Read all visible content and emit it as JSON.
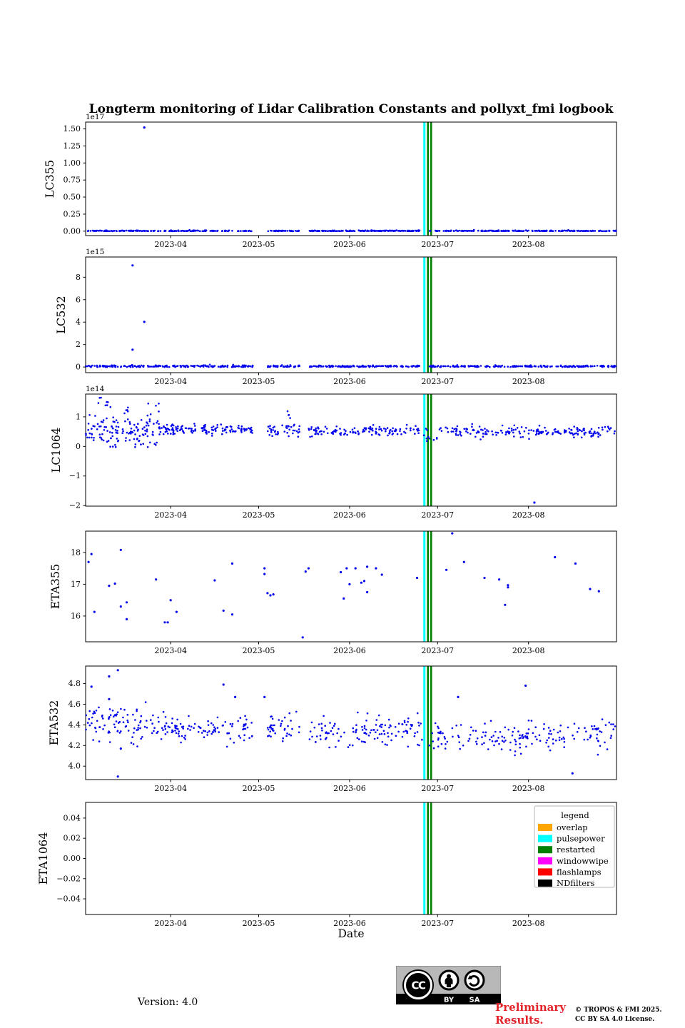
{
  "chart_data": {
    "type": "scatter",
    "title": "Longterm monitoring of Lidar Calibration Constants and pollyxt_fmi logbook",
    "xlabel": "Date",
    "x_start_date": "2023-03-03",
    "x_span_days": 181,
    "grid": false,
    "point_color": "#0000ee",
    "xticks": [
      {
        "day": 29,
        "label": "2023-04"
      },
      {
        "day": 59,
        "label": "2023-05"
      },
      {
        "day": 90,
        "label": "2023-06"
      },
      {
        "day": 120,
        "label": "2023-07"
      },
      {
        "day": 151,
        "label": "2023-08"
      }
    ],
    "events": [
      {
        "type": "pulsepower",
        "day": 115.5,
        "color": "#00ffff",
        "width": 3
      },
      {
        "type": "restarted",
        "day": 116.7,
        "color": "#008000",
        "width": 2.6
      },
      {
        "type": "restarted",
        "day": 117.8,
        "color": "#008000",
        "width": 2.6
      }
    ],
    "subplots": [
      {
        "ylabel": "LC355",
        "scale_label": "1e17",
        "ylim": [
          -0.065,
          1.6
        ],
        "yticks": [
          {
            "v": 0.0,
            "label": "0.00"
          },
          {
            "v": 0.25,
            "label": "0.25"
          },
          {
            "v": 0.5,
            "label": "0.50"
          },
          {
            "v": 0.75,
            "label": "0.75"
          },
          {
            "v": 1.0,
            "label": "1.00"
          },
          {
            "v": 1.25,
            "label": "1.25"
          },
          {
            "v": 1.5,
            "label": "1.50"
          }
        ],
        "seed": 101,
        "clusters": [
          [
            0,
            57,
            190,
            0.004,
            0.004,
            0,
            0.025
          ],
          [
            62,
            73,
            42,
            0.004,
            0.004,
            0,
            0.02
          ],
          [
            76,
            114,
            150,
            0.004,
            0.004,
            0,
            0.02
          ],
          [
            117,
            181,
            210,
            0.004,
            0.004,
            0,
            0.02
          ]
        ],
        "outliers": [
          [
            20,
            1.52
          ]
        ]
      },
      {
        "ylabel": "LC532",
        "scale_label": "1e15",
        "ylim": [
          -0.5,
          9.8
        ],
        "yticks": [
          {
            "v": 0,
            "label": "0"
          },
          {
            "v": 2,
            "label": "2"
          },
          {
            "v": 4,
            "label": "4"
          },
          {
            "v": 6,
            "label": "6"
          },
          {
            "v": 8,
            "label": "8"
          }
        ],
        "seed": 102,
        "clusters": [
          [
            0,
            57,
            190,
            0.07,
            0.05,
            0,
            0.3
          ],
          [
            62,
            73,
            42,
            0.07,
            0.05,
            0,
            0.25
          ],
          [
            76,
            114,
            150,
            0.06,
            0.04,
            0,
            0.22
          ],
          [
            117,
            181,
            210,
            0.06,
            0.04,
            0,
            0.22
          ]
        ],
        "outliers": [
          [
            16,
            9.05
          ],
          [
            16,
            1.55
          ],
          [
            20,
            4.02
          ]
        ]
      },
      {
        "ylabel": "LC1064",
        "scale_label": "1e14",
        "ylim": [
          -2.02,
          1.77
        ],
        "yticks": [
          {
            "v": -2,
            "label": "−2"
          },
          {
            "v": -1,
            "label": "−1"
          },
          {
            "v": 0,
            "label": "0"
          },
          {
            "v": 1,
            "label": "1"
          }
        ],
        "seed": 103,
        "clusters": [
          [
            0,
            22,
            115,
            0.5,
            0.25,
            -0.02,
            1.1
          ],
          [
            4,
            9,
            9,
            1.5,
            0.1,
            1.33,
            1.65
          ],
          [
            12,
            15,
            5,
            1.18,
            0.12,
            1.0,
            1.4
          ],
          [
            21,
            25,
            20,
            0.8,
            0.38,
            0.05,
            1.45
          ],
          [
            25,
            57,
            135,
            0.57,
            0.08,
            0.28,
            0.85
          ],
          [
            62,
            73,
            40,
            0.55,
            0.11,
            0.15,
            0.9
          ],
          [
            67,
            70,
            4,
            1.05,
            0.1,
            0.9,
            1.2
          ],
          [
            76,
            114,
            125,
            0.53,
            0.09,
            0.2,
            0.8
          ],
          [
            115,
            120,
            10,
            0.35,
            0.15,
            0.02,
            0.6
          ],
          [
            120,
            181,
            185,
            0.5,
            0.09,
            0.08,
            0.78
          ]
        ],
        "outliers": [
          [
            153,
            -1.9
          ]
        ]
      },
      {
        "ylabel": "ETA355",
        "scale_label": "",
        "ylim": [
          15.19,
          18.67
        ],
        "yticks": [
          {
            "v": 16,
            "label": "16"
          },
          {
            "v": 17,
            "label": "17"
          },
          {
            "v": 18,
            "label": "18"
          }
        ],
        "seed": 104,
        "clusters": [],
        "points": [
          [
            1,
            17.7
          ],
          [
            2,
            17.95
          ],
          [
            3,
            16.13
          ],
          [
            8,
            16.95
          ],
          [
            10,
            17.02
          ],
          [
            12,
            18.08
          ],
          [
            12,
            16.3
          ],
          [
            14,
            16.43
          ],
          [
            14,
            15.9
          ],
          [
            24,
            17.15
          ],
          [
            27,
            15.8
          ],
          [
            28,
            15.8
          ],
          [
            29,
            16.5
          ],
          [
            31,
            16.13
          ],
          [
            44,
            17.12
          ],
          [
            47,
            16.17
          ],
          [
            50,
            17.65
          ],
          [
            50,
            16.05
          ],
          [
            61,
            17.5
          ],
          [
            61,
            17.32
          ],
          [
            62,
            16.72
          ],
          [
            63,
            16.65
          ],
          [
            64,
            16.68
          ],
          [
            74,
            15.33
          ],
          [
            75,
            17.4
          ],
          [
            76,
            17.5
          ],
          [
            87,
            17.38
          ],
          [
            88,
            16.55
          ],
          [
            89,
            17.5
          ],
          [
            90,
            17.0
          ],
          [
            92,
            17.5
          ],
          [
            94,
            17.05
          ],
          [
            95,
            17.1
          ],
          [
            96,
            17.55
          ],
          [
            96,
            16.75
          ],
          [
            99,
            17.5
          ],
          [
            101,
            17.3
          ],
          [
            113,
            17.2
          ],
          [
            123,
            17.45
          ],
          [
            125,
            18.6
          ],
          [
            129,
            17.7
          ],
          [
            136,
            17.2
          ],
          [
            141,
            17.15
          ],
          [
            144,
            16.97
          ],
          [
            144,
            16.9
          ],
          [
            143,
            16.35
          ],
          [
            160,
            17.85
          ],
          [
            167,
            17.65
          ],
          [
            172,
            16.85
          ],
          [
            175,
            16.78
          ]
        ]
      },
      {
        "ylabel": "ETA532",
        "scale_label": "",
        "ylim": [
          3.87,
          4.97
        ],
        "yticks": [
          {
            "v": 4.0,
            "label": "4.0"
          },
          {
            "v": 4.2,
            "label": "4.2"
          },
          {
            "v": 4.4,
            "label": "4.4"
          },
          {
            "v": 4.6,
            "label": "4.6"
          },
          {
            "v": 4.8,
            "label": "4.8"
          }
        ],
        "seed": 105,
        "clusters": [
          [
            0,
            22,
            85,
            4.4,
            0.09,
            4.16,
            4.62
          ],
          [
            22,
            57,
            115,
            4.38,
            0.07,
            4.18,
            4.58
          ],
          [
            62,
            73,
            40,
            4.37,
            0.07,
            4.2,
            4.56
          ],
          [
            76,
            115,
            125,
            4.34,
            0.07,
            4.12,
            4.55
          ],
          [
            117,
            151,
            95,
            4.27,
            0.07,
            4.05,
            4.48
          ],
          [
            151,
            181,
            75,
            4.3,
            0.07,
            4.08,
            4.52
          ]
        ],
        "outliers": [
          [
            2,
            4.77
          ],
          [
            8,
            4.87
          ],
          [
            11,
            4.93
          ],
          [
            8,
            4.65
          ],
          [
            12,
            4.17
          ],
          [
            11,
            3.9
          ],
          [
            47,
            4.79
          ],
          [
            51,
            4.67
          ],
          [
            61,
            4.67
          ],
          [
            127,
            4.67
          ],
          [
            150,
            4.78
          ],
          [
            166,
            3.93
          ]
        ]
      },
      {
        "ylabel": "ETA1064",
        "scale_label": "",
        "ylim": [
          -0.0555,
          0.0555
        ],
        "yticks": [
          {
            "v": -0.04,
            "label": "−0.04"
          },
          {
            "v": -0.02,
            "label": "−0.02"
          },
          {
            "v": 0.0,
            "label": "0.00"
          },
          {
            "v": 0.02,
            "label": "0.02"
          },
          {
            "v": 0.04,
            "label": "0.04"
          }
        ],
        "seed": 106,
        "clusters": [],
        "has_legend": true
      }
    ],
    "legend": {
      "title": "legend",
      "entries": [
        {
          "label": "overlap",
          "color": "#ffa500"
        },
        {
          "label": "pulsepower",
          "color": "#00ffff"
        },
        {
          "label": "restarted",
          "color": "#008000"
        },
        {
          "label": "windowwipe",
          "color": "#ff00ff"
        },
        {
          "label": "flashlamps",
          "color": "#ff0000"
        },
        {
          "label": "NDfilters",
          "color": "#000000"
        }
      ]
    }
  },
  "footer": {
    "version_label": "Version: 4.0",
    "preliminary_line1": "Preliminary",
    "preliminary_line2": "Results.",
    "preliminary_color": "#e3242b",
    "copyright_line1": "© TROPOS & FMI 2025.",
    "copyright_line2": "CC BY SA 4.0 License.",
    "badge": {
      "cc_label": "CC",
      "by_label": "BY",
      "sa_label": "SA"
    }
  }
}
